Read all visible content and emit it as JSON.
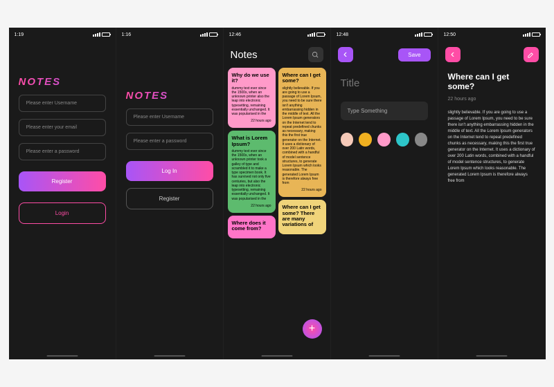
{
  "status": {
    "time1": "1:19",
    "time2": "1:16",
    "time3": "12:46",
    "time4": "12:48",
    "time5": "12:50"
  },
  "app": {
    "logo": "NOTES"
  },
  "register": {
    "username_ph": "Please enter Username",
    "email_ph": "Please enter your email",
    "password_ph": "Please enter a password",
    "register_label": "Register",
    "login_label": "Login"
  },
  "login": {
    "username_ph": "Please enter Username",
    "password_ph": "Please enter a password",
    "login_label": "Log In",
    "register_label": "Register"
  },
  "notes_list": {
    "title": "Notes",
    "cards": [
      {
        "title": "Why do we use it?",
        "body": "dummy text ever since the 1500s, when an unknown printer also the leap into electronic typesetting, remaining essentially unchanged. It was popularised in the",
        "ago": "22 hours ago"
      },
      {
        "title": "What is Lorem Ipsum?",
        "body": "dummy text ever since the 1500s, when an unknown printer took a galley of type and scrambled it to make a type specimen book. It has survived not only five centuries, but also the leap into electronic typesetting, remaining essentially unchanged. It was popularised in the",
        "ago": "22 hours ago"
      },
      {
        "title": "Where does it come from?",
        "body": "",
        "ago": ""
      },
      {
        "title": "Where can I get some?",
        "body": "slightly believable. If you are going to use a passage of Lorem Ipsum, you need to be sure there isn't anything embarrassing hidden in the middle of text. All the Lorem Ipsum generators on the Internet tend to repeat predefined chunks as necessary, making this the first true generator on the Internet. It uses a dictionary of over 200 Latin words, combined with a handful of model sentence structures, to generate Lorem Ipsum which looks reasonable. The generated Lorem Ipsum is therefore always free from",
        "ago": "22 hours ago"
      },
      {
        "title": "Where can I get some? There are many variations of",
        "body": "",
        "ago": ""
      }
    ]
  },
  "editor": {
    "save_label": "Save",
    "title_ph": "Title",
    "body_ph": "Type Something",
    "colors": [
      "#f5c9b8",
      "#f0b020",
      "#ff9ac9",
      "#2dc5c9",
      "#888"
    ]
  },
  "detail": {
    "title": "Where can I get some?",
    "meta": "22 hours ago",
    "body": "slightly believable. If you are going to use a passage of Lorem Ipsum, you need to be sure there isn't anything embarrassing hidden in the middle of text. All the Lorem Ipsum generators on the Internet tend to repeat predefined chunks as necessary, making this the first true generator on the Internet. It uses a dictionary of over 200 Latin words, combined with a handful of model sentence structures, to generate Lorem Ipsum which looks reasonable. The generated Lorem Ipsum is therefore always free from"
  }
}
